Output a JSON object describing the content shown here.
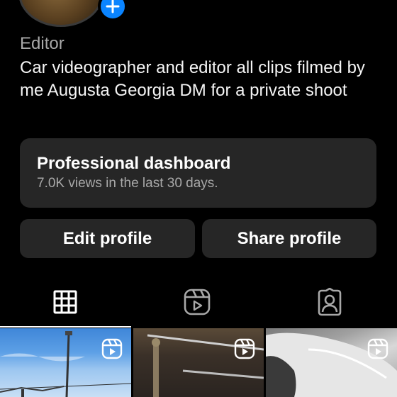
{
  "profile": {
    "category": "Editor",
    "bio": "Car videographer and editor all clips filmed by me Augusta Georgia DM for a private shoot"
  },
  "dashboard": {
    "title": "Professional dashboard",
    "subtitle": "7.0K views in the last 30 days."
  },
  "actions": {
    "edit_label": "Edit profile",
    "share_label": "Share profile"
  },
  "tabs": [
    {
      "name": "posts-grid",
      "icon": "grid-icon",
      "active": true
    },
    {
      "name": "reels",
      "icon": "reels-icon",
      "active": false
    },
    {
      "name": "tagged",
      "icon": "tagged-person-icon",
      "active": false
    }
  ],
  "thumbnails": [
    {
      "type": "reel",
      "icon": "reel-badge-icon"
    },
    {
      "type": "reel",
      "icon": "reel-badge-icon"
    },
    {
      "type": "reel",
      "icon": "reel-badge-icon"
    }
  ],
  "colors": {
    "background": "#000000",
    "card": "#262626",
    "accent": "#0a84ff",
    "secondary_text": "#a8a8a8"
  }
}
